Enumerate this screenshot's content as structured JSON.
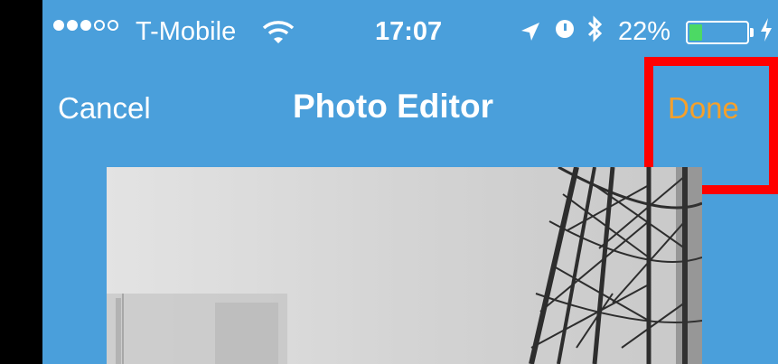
{
  "status_bar": {
    "carrier": "T-Mobile",
    "time": "17:07",
    "battery_percent_text": "22%",
    "battery_level": 0.22,
    "signal_bars_filled": 3,
    "signal_bars_total": 5,
    "icons": [
      "signal-icon",
      "wifi-icon",
      "location-icon",
      "alarm-icon",
      "bluetooth-icon",
      "battery-icon",
      "charging-icon"
    ]
  },
  "nav_bar": {
    "cancel_label": "Cancel",
    "title": "Photo Editor",
    "done_label": "Done"
  },
  "colors": {
    "background": "#4a9fdb",
    "done_accent": "#f6a02a",
    "highlight": "#ff0000",
    "battery_fill": "#4cd964"
  }
}
